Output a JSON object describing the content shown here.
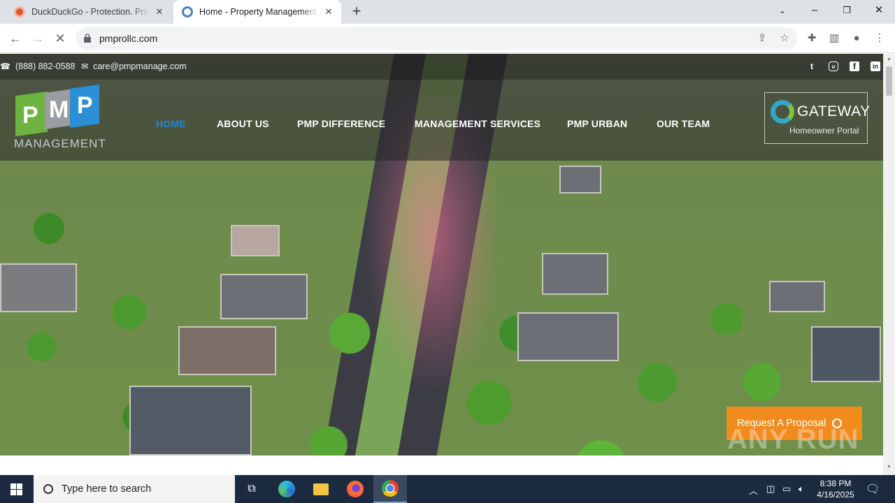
{
  "browser": {
    "tabs": [
      {
        "title": "DuckDuckGo - Protection. Privacy",
        "active": false
      },
      {
        "title": "Home - Property Management Professionals",
        "active": true
      }
    ],
    "url": "pmprollc.com"
  },
  "site": {
    "topbar": {
      "phone": "(888) 882-0588",
      "email": "care@pmpmanage.com",
      "social_icons": [
        "twitter-icon",
        "instagram-icon",
        "facebook-icon",
        "linkedin-icon"
      ]
    },
    "logo": {
      "letters": [
        "P",
        "M",
        "P"
      ],
      "subtitle": "MANAGEMENT"
    },
    "nav": {
      "items": [
        "HOME",
        "ABOUT US",
        "PMP DIFFERENCE",
        "MANAGEMENT SERVICES",
        "PMP URBAN",
        "OUR TEAM"
      ],
      "active": "HOME"
    },
    "gateway": {
      "title": "GATEWAY",
      "subtitle": "Homeowner Portal"
    },
    "cta": {
      "label": "Request A Proposal"
    },
    "watermark": "ANY RUN"
  },
  "taskbar": {
    "search_placeholder": "Type here to search",
    "time": "8:38 PM",
    "date": "4/16/2025"
  },
  "colors": {
    "nav_active": "#1e88d9",
    "cta_bg": "#f28b1e",
    "logo_green": "#6db33f",
    "logo_blue": "#2b8fd6",
    "logo_gray": "#9a9da2"
  }
}
